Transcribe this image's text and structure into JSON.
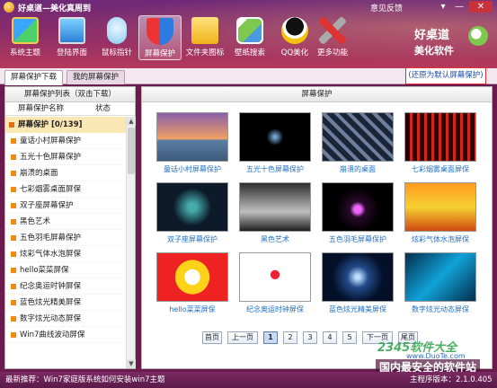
{
  "window": {
    "title": "好桌道—美化真周到",
    "feedback": "意见反馈",
    "menu_icon": "▾",
    "min_icon": "—",
    "close_icon": "✕"
  },
  "toolbar": {
    "items": [
      {
        "label": "系统主题",
        "icon": "theme-icon"
      },
      {
        "label": "登陆界面",
        "icon": "login-screen-icon"
      },
      {
        "label": "鼠标指针",
        "icon": "mouse-icon"
      },
      {
        "label": "屏幕保护",
        "icon": "shield-icon",
        "active": true
      },
      {
        "label": "文件夹图标",
        "icon": "folder-icon"
      },
      {
        "label": "壁纸搜索",
        "icon": "wallpaper-icon"
      },
      {
        "label": "QQ美化",
        "icon": "qq-icon"
      },
      {
        "label": "更多功能",
        "icon": "tools-icon"
      }
    ]
  },
  "logo": {
    "line1": "好桌道",
    "line2": "美化软件"
  },
  "tabs": [
    {
      "label": "屏幕保护下载",
      "active": true
    },
    {
      "label": "我的屏幕保护",
      "active": false
    }
  ],
  "restore_link": "(还原为默认屏幕保护)",
  "left_panel": {
    "header": "屏幕保护列表（双击下载）",
    "col_name": "屏幕保护名称",
    "col_state": "状态",
    "group": "屏幕保护 [0/139]",
    "items": [
      "童话小村屏幕保护",
      "五光十色屏幕保护",
      "崩溃的桌面",
      "七彩烟雾桌面屏保",
      "双子座屏幕保护",
      "黑色艺术",
      "五色羽毛屏幕保护",
      "炫彩气体水泡屏保",
      "hello菜菜屏保",
      "纪念奥运时钟屏保",
      "蓝色炫光精美屏保",
      "数字炫光动态屏保",
      "Win7曲线波动屏保"
    ],
    "scroll_up": "▲",
    "scroll_down": "▼"
  },
  "right_panel": {
    "header": "屏幕保护",
    "thumbnails": [
      "童话小村屏幕保护",
      "五光十色屏幕保护",
      "崩溃的桌面",
      "七彩烟雾桌面屏保",
      "双子座屏幕保护",
      "黑色艺术",
      "五色羽毛屏幕保护",
      "炫彩气体水泡屏保",
      "hello菜菜屏保",
      "纪念奥运时钟屏保",
      "蓝色炫光精美屏保",
      "数字炫光动态屏保"
    ],
    "pager": {
      "first": "首页",
      "prev": "上一页",
      "pages": [
        "1",
        "2",
        "3",
        "4",
        "5"
      ],
      "current": "1",
      "next": "下一页",
      "last": "尾页"
    }
  },
  "watermark": {
    "brand": "2345软件大全",
    "url": "www.DuoTe.com"
  },
  "slogan": "国内最安全的软件站",
  "status": {
    "news": "最新推荐：Win7家庭版系统如何安装win7主题",
    "version": "主程序版本：2.1.0.405"
  }
}
